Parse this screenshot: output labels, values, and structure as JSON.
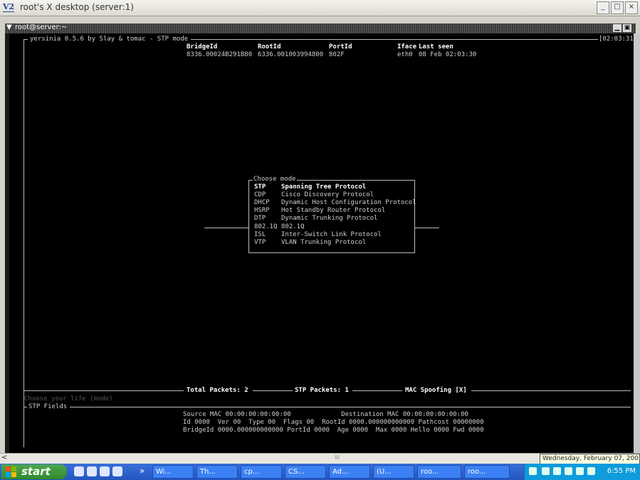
{
  "window": {
    "title": "root's X desktop (server:1)",
    "app_icon": "V2"
  },
  "terminal": {
    "title": "root@server:~",
    "header_left": "yersinia 0.5.6 by Slay & tomac - STP mode",
    "header_time": "[02:03:31",
    "columns": [
      "BridgeId",
      "RootId",
      "PortId",
      "Iface",
      "Last seen"
    ],
    "row": {
      "bridge": "8336.00024B291B80",
      "root": "6336.001003994800",
      "port": "802F",
      "iface": "eth0",
      "seen": "08 Feb 02:03:30"
    },
    "mode_menu": {
      "title": "Choose mode",
      "items": [
        {
          "code": "STP",
          "name": "Spanning Tree Protocol"
        },
        {
          "code": "CDP",
          "name": "Cisco Discovery Protocol"
        },
        {
          "code": "DHCP",
          "name": "Dynamic Host Configuration Protocol"
        },
        {
          "code": "HSRP",
          "name": "Hot Standby Router Protocol"
        },
        {
          "code": "DTP",
          "name": "Dynamic Trunking Protocol"
        },
        {
          "code": "802.1Q",
          "name": "802.1Q"
        },
        {
          "code": "ISL",
          "name": "Inter-Switch Link Protocol"
        },
        {
          "code": "VTP",
          "name": "VLAN Trunking Protocol"
        }
      ]
    },
    "status": {
      "total": "Total Packets: 2",
      "stp": "STP Packets: 1",
      "mac": "MAC Spoofing [X]"
    },
    "prompt_hint": "Choose your life (mode)",
    "fields_title": "STP Fields",
    "fields_lines": [
      "Source MAC 00:00:00:00:00:00             Destination MAC 00:00:00:00:00:00",
      "Id 0000  Ver 00  Type 00  Flags 00  RootId 0000.000000000000 Pathcost 00000000",
      "BridgeId 0000.000000000000 PortId 0000  Age 0000  Max 0000 Hello 0000 Fwd 0000"
    ]
  },
  "hscroll_mark": "III",
  "tooltip": "Wednesday, February 07, 2007",
  "taskbar": {
    "start": "start",
    "overflow": "»",
    "tasks": [
      "Wi...",
      "Th...",
      "cp...",
      "CS...",
      "Ad...",
      "(U...",
      "roo...",
      "roo..."
    ],
    "clock": "6:55 PM"
  }
}
